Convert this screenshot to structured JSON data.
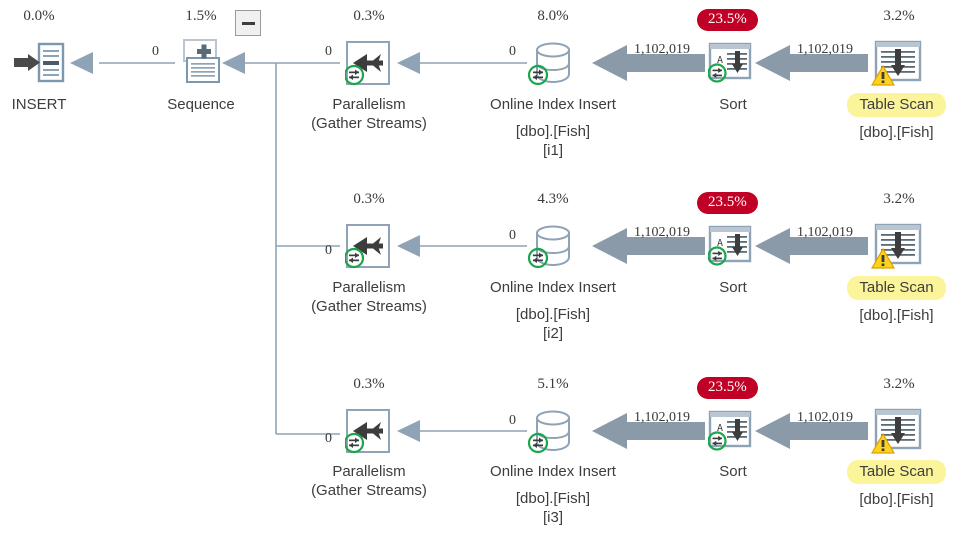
{
  "plan": {
    "title": "SQL Server Execution Plan",
    "collapse_button": {
      "name": "collapse-toggle",
      "glyph": "minus"
    },
    "accent_colors": {
      "badge_red": "#c00024",
      "highlight_yellow": "#fbf49a",
      "thick_arrow_gray": "#8b9aa8",
      "thin_arrow_gray": "#8ea3b5",
      "icon_blue_gray": "#7d97ac",
      "warning_yellow": "#ffd21e",
      "parallel_green": "#1aa64b"
    },
    "nodes": [
      {
        "id": "insert",
        "cost": "0.0%",
        "cost_style": "plain",
        "label": "INSERT",
        "sub1": "",
        "sub2": "",
        "icon": "insert-icon",
        "highlight": false,
        "parallel": false,
        "warning": false
      },
      {
        "id": "sequence",
        "cost": "1.5%",
        "cost_style": "plain",
        "label": "Sequence",
        "sub1": "",
        "sub2": "",
        "icon": "sequence-icon",
        "highlight": false,
        "parallel": false,
        "warning": false
      },
      {
        "id": "parallelism-1",
        "cost": "0.3%",
        "cost_style": "plain",
        "label": "Parallelism",
        "sub1": "(Gather Streams)",
        "sub2": "",
        "icon": "parallelism-icon",
        "highlight": false,
        "parallel": true,
        "warning": false
      },
      {
        "id": "online-index-insert-1",
        "cost": "8.0%",
        "cost_style": "plain",
        "label": "Online Index Insert",
        "sub1": "[dbo].[Fish]",
        "sub2": "[i1]",
        "icon": "index-insert-icon",
        "highlight": false,
        "parallel": true,
        "warning": false
      },
      {
        "id": "sort-1",
        "cost": "23.5%",
        "cost_style": "badge",
        "label": "Sort",
        "sub1": "",
        "sub2": "",
        "icon": "sort-icon",
        "highlight": false,
        "parallel": true,
        "warning": false
      },
      {
        "id": "table-scan-1",
        "cost": "3.2%",
        "cost_style": "plain",
        "label": "Table Scan",
        "sub1": "[dbo].[Fish]",
        "sub2": "",
        "icon": "table-scan-icon",
        "highlight": true,
        "parallel": false,
        "warning": true
      },
      {
        "id": "parallelism-2",
        "cost": "0.3%",
        "cost_style": "plain",
        "label": "Parallelism",
        "sub1": "(Gather Streams)",
        "sub2": "",
        "icon": "parallelism-icon",
        "highlight": false,
        "parallel": true,
        "warning": false
      },
      {
        "id": "online-index-insert-2",
        "cost": "4.3%",
        "cost_style": "plain",
        "label": "Online Index Insert",
        "sub1": "[dbo].[Fish]",
        "sub2": "[i2]",
        "icon": "index-insert-icon",
        "highlight": false,
        "parallel": true,
        "warning": false
      },
      {
        "id": "sort-2",
        "cost": "23.5%",
        "cost_style": "badge",
        "label": "Sort",
        "sub1": "",
        "sub2": "",
        "icon": "sort-icon",
        "highlight": false,
        "parallel": true,
        "warning": false
      },
      {
        "id": "table-scan-2",
        "cost": "3.2%",
        "cost_style": "plain",
        "label": "Table Scan",
        "sub1": "[dbo].[Fish]",
        "sub2": "",
        "icon": "table-scan-icon",
        "highlight": true,
        "parallel": false,
        "warning": true
      },
      {
        "id": "parallelism-3",
        "cost": "0.3%",
        "cost_style": "plain",
        "label": "Parallelism",
        "sub1": "(Gather Streams)",
        "sub2": "",
        "icon": "parallelism-icon",
        "highlight": false,
        "parallel": true,
        "warning": false
      },
      {
        "id": "online-index-insert-3",
        "cost": "5.1%",
        "cost_style": "plain",
        "label": "Online Index Insert",
        "sub1": "[dbo].[Fish]",
        "sub2": "[i3]",
        "icon": "index-insert-icon",
        "highlight": false,
        "parallel": true,
        "warning": false
      },
      {
        "id": "sort-3",
        "cost": "23.5%",
        "cost_style": "badge",
        "label": "Sort",
        "sub1": "",
        "sub2": "",
        "icon": "sort-icon",
        "highlight": false,
        "parallel": true,
        "warning": false
      },
      {
        "id": "table-scan-3",
        "cost": "3.2%",
        "cost_style": "plain",
        "label": "Table Scan",
        "sub1": "[dbo].[Fish]",
        "sub2": "",
        "icon": "table-scan-icon",
        "highlight": true,
        "parallel": false,
        "warning": true
      }
    ],
    "row_labels": {
      "insert_from_sequence": "0",
      "sequence_from_branch": "",
      "parallelism_1_out": "0",
      "index_insert_1_out": "0",
      "sort_1_out": "1,102,019",
      "table_scan_1_out": "1,102,019",
      "parallelism_2_out": "0",
      "index_insert_2_out": "0",
      "sort_2_out": "1,102,019",
      "table_scan_2_out": "1,102,019",
      "parallelism_3_out": "0",
      "index_insert_3_out": "0",
      "sort_3_out": "1,102,019",
      "table_scan_3_out": "1,102,019"
    }
  }
}
